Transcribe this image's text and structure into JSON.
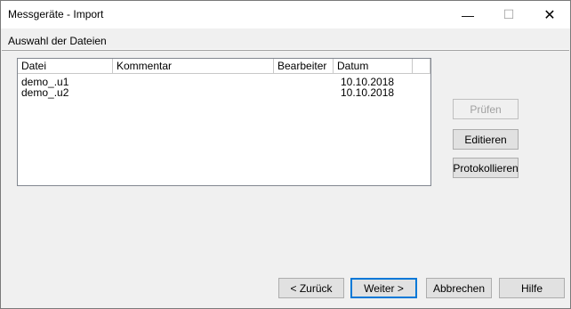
{
  "window": {
    "title": "Messgeräte - Import",
    "minimize_glyph": "—",
    "maximize_glyph": "☐",
    "close_glyph": "✕"
  },
  "section": {
    "label": "Auswahl der Dateien"
  },
  "file_list": {
    "columns": [
      "Datei",
      "Kommentar",
      "Bearbeiter",
      "Datum",
      ""
    ],
    "rows": [
      {
        "datei": "demo_.u1",
        "kommentar": "",
        "bearbeiter": "",
        "datum": "10.10.2018"
      },
      {
        "datei": "demo_.u2",
        "kommentar": "",
        "bearbeiter": "",
        "datum": "10.10.2018"
      }
    ]
  },
  "side_buttons": {
    "pruefen": "Prüfen",
    "editieren": "Editieren",
    "protokollieren": "Protokollieren"
  },
  "footer_buttons": {
    "zurueck": "< Zurück",
    "weiter": "Weiter >",
    "abbrechen": "Abbrechen",
    "hilfe": "Hilfe"
  }
}
